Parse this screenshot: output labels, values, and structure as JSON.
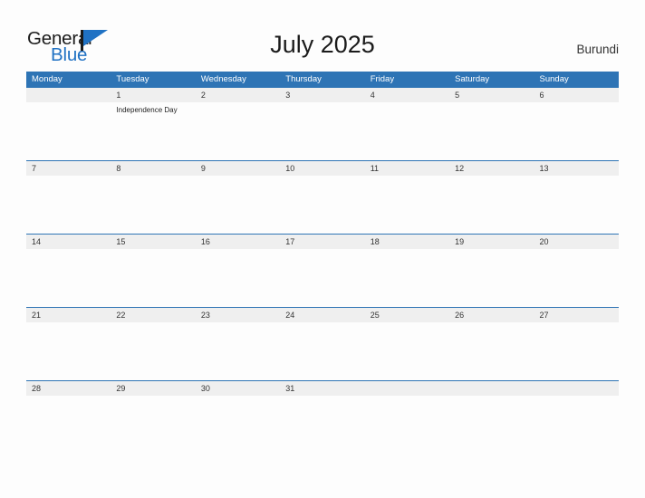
{
  "brand": {
    "name_top": "General",
    "name_bottom": "Blue",
    "flag_icon": "flag-triangle-icon",
    "color_primary": "#2072c4",
    "color_text": "#1b1b1b"
  },
  "header": {
    "title": "July 2025",
    "country": "Burundi"
  },
  "theme": {
    "header_blue": "#2e74b5",
    "band_gray": "#efefef",
    "page_background": "#fdfdfd",
    "rule_blue": "#2e74b5"
  },
  "weekdays": [
    "Monday",
    "Tuesday",
    "Wednesday",
    "Thursday",
    "Friday",
    "Saturday",
    "Sunday"
  ],
  "weeks": [
    {
      "days": [
        {
          "num": "",
          "events": []
        },
        {
          "num": "1",
          "events": [
            "Independence Day"
          ]
        },
        {
          "num": "2",
          "events": []
        },
        {
          "num": "3",
          "events": []
        },
        {
          "num": "4",
          "events": []
        },
        {
          "num": "5",
          "events": []
        },
        {
          "num": "6",
          "events": []
        }
      ]
    },
    {
      "days": [
        {
          "num": "7",
          "events": []
        },
        {
          "num": "8",
          "events": []
        },
        {
          "num": "9",
          "events": []
        },
        {
          "num": "10",
          "events": []
        },
        {
          "num": "11",
          "events": []
        },
        {
          "num": "12",
          "events": []
        },
        {
          "num": "13",
          "events": []
        }
      ]
    },
    {
      "days": [
        {
          "num": "14",
          "events": []
        },
        {
          "num": "15",
          "events": []
        },
        {
          "num": "16",
          "events": []
        },
        {
          "num": "17",
          "events": []
        },
        {
          "num": "18",
          "events": []
        },
        {
          "num": "19",
          "events": []
        },
        {
          "num": "20",
          "events": []
        }
      ]
    },
    {
      "days": [
        {
          "num": "21",
          "events": []
        },
        {
          "num": "22",
          "events": []
        },
        {
          "num": "23",
          "events": []
        },
        {
          "num": "24",
          "events": []
        },
        {
          "num": "25",
          "events": []
        },
        {
          "num": "26",
          "events": []
        },
        {
          "num": "27",
          "events": []
        }
      ]
    },
    {
      "days": [
        {
          "num": "28",
          "events": []
        },
        {
          "num": "29",
          "events": []
        },
        {
          "num": "30",
          "events": []
        },
        {
          "num": "31",
          "events": []
        },
        {
          "num": "",
          "events": []
        },
        {
          "num": "",
          "events": []
        },
        {
          "num": "",
          "events": []
        }
      ]
    }
  ]
}
